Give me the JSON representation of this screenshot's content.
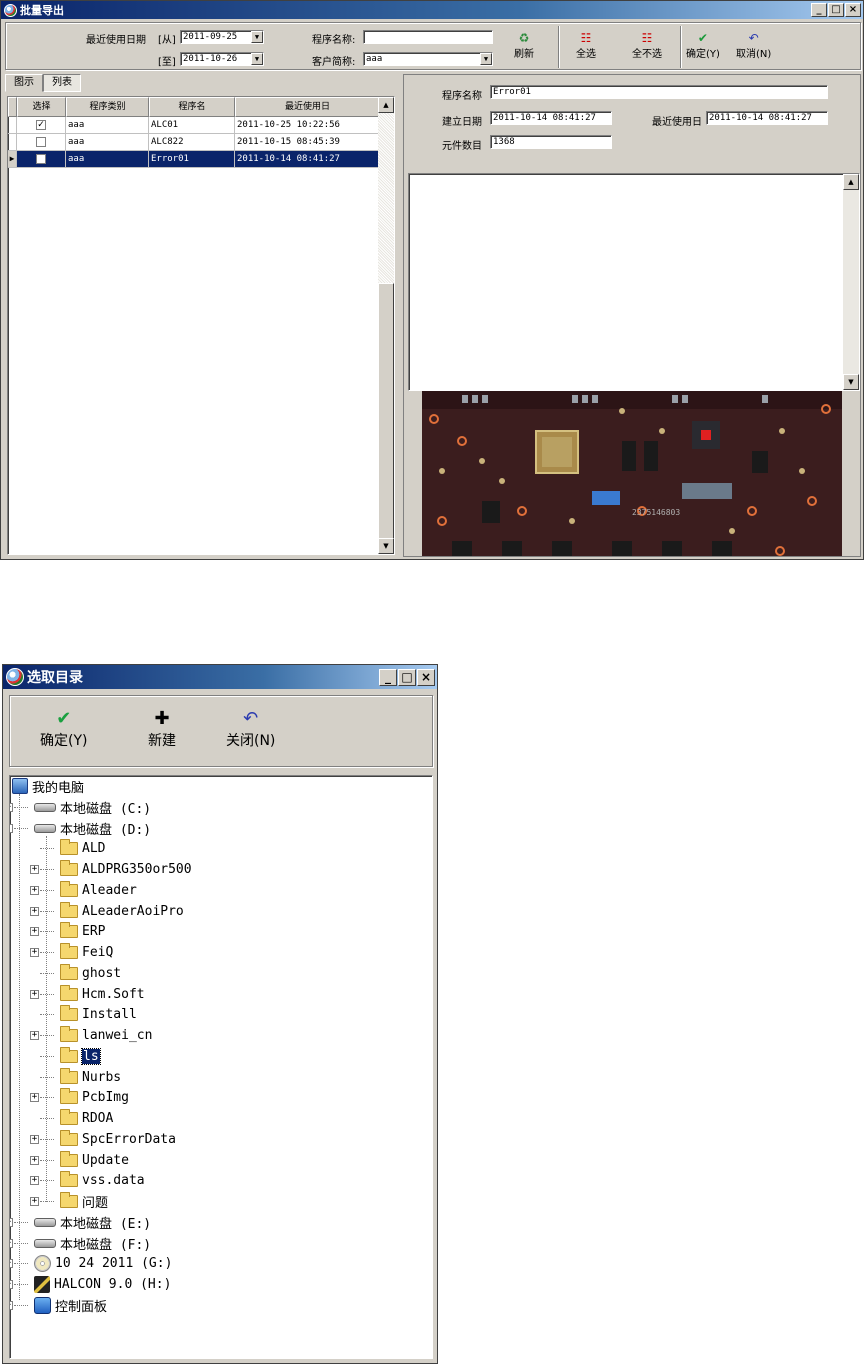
{
  "window1": {
    "title": "批量导出",
    "controls": {
      "minimize": "_",
      "maximize": "□",
      "close": "×"
    },
    "filters": {
      "last_used_label": "最近使用日期",
      "from_label": "[从]",
      "to_label": "[至]",
      "from_date": "2011-09-25",
      "to_date": "2011-10-26",
      "program_name_label": "程序名称:",
      "program_name_value": "",
      "customer_label": "客户简称:",
      "customer_value": "aaa"
    },
    "buttons": {
      "refresh": "刷新",
      "select_all": "全选",
      "select_none": "全不选",
      "ok": "确定(Y)",
      "cancel": "取消(N)"
    },
    "tabs": [
      "图示",
      "列表"
    ],
    "active_tab": "列表",
    "grid": {
      "columns": [
        "选择",
        "程序类别",
        "程序名",
        "最近使用日"
      ],
      "rows": [
        {
          "checked": true,
          "category": "aaa",
          "name": "ALC01",
          "date": "2011-10-25 10:22:56"
        },
        {
          "checked": false,
          "category": "aaa",
          "name": "ALC822",
          "date": "2011-10-15 08:45:39"
        },
        {
          "checked": false,
          "category": "aaa",
          "name": "Error01",
          "date": "2011-10-14 08:41:27",
          "selected": true
        }
      ]
    },
    "detail": {
      "program_name_label": "程序名称",
      "program_name": "Error01",
      "created_label": "建立日期",
      "created": "2011-10-14 08:41:27",
      "last_used_label": "最近使用日",
      "last_used": "2011-10-14 08:41:27",
      "component_count_label": "元件数目",
      "component_count": "1368"
    },
    "preview_board_text": [
      "2375146803"
    ],
    "colors": {
      "title_start": "#0a246a",
      "selection": "#0a246a",
      "face": "#d4d0c8"
    }
  },
  "window2": {
    "title": "选取目录",
    "controls": {
      "minimize": "_",
      "maximize": "□",
      "close": "×"
    },
    "buttons": {
      "ok": "确定(Y)",
      "new": "新建",
      "close": "关闭(N)"
    },
    "tree": {
      "root": "我的电脑",
      "drives_before": [
        "本地磁盘 (C:)",
        "本地磁盘 (D:)"
      ],
      "folders": [
        {
          "name": "ALD",
          "expandable": false
        },
        {
          "name": "ALDPRG350or500",
          "expandable": true
        },
        {
          "name": "Aleader",
          "expandable": true
        },
        {
          "name": "ALeaderAoiPro",
          "expandable": true
        },
        {
          "name": "ERP",
          "expandable": true
        },
        {
          "name": "FeiQ",
          "expandable": true
        },
        {
          "name": "ghost",
          "expandable": false
        },
        {
          "name": "Hcm.Soft",
          "expandable": true
        },
        {
          "name": "Install",
          "expandable": false
        },
        {
          "name": "lanwei_cn",
          "expandable": true
        },
        {
          "name": "ls",
          "expandable": false,
          "selected": true
        },
        {
          "name": "Nurbs",
          "expandable": false
        },
        {
          "name": "PcbImg",
          "expandable": true
        },
        {
          "name": "RDOA",
          "expandable": false
        },
        {
          "name": "SpcErrorData",
          "expandable": true
        },
        {
          "name": "Update",
          "expandable": true
        },
        {
          "name": "vss.data",
          "expandable": true
        },
        {
          "name": "问题",
          "expandable": true
        }
      ],
      "drives_after": [
        "本地磁盘 (E:)",
        "本地磁盘 (F:)",
        "10 24 2011 (G:)",
        "HALCON 9.0 (H:)",
        "控制面板"
      ]
    }
  }
}
